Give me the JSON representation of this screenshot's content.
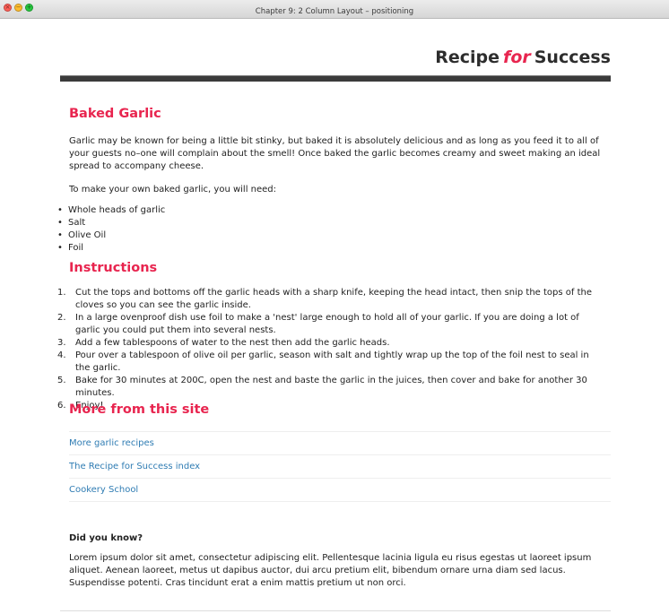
{
  "window": {
    "title": "Chapter 9: 2 Column Layout – positioning"
  },
  "site": {
    "title_part1": "Recipe",
    "title_part2": "for",
    "title_part3": "Success"
  },
  "article": {
    "heading": "Baked Garlic",
    "intro": "Garlic may be known for being a little bit stinky, but baked it is absolutely delicious and as long as you feed it to all of your guests no–one will complain about the smell! Once baked the garlic becomes creamy and sweet making an ideal spread to accompany cheese.",
    "needs": "To make your own baked garlic, you will need:",
    "ingredients": [
      "Whole heads of garlic",
      "Salt",
      "Olive Oil",
      "Foil"
    ],
    "instructions_heading": "Instructions",
    "steps": [
      "Cut the tops and bottoms off the garlic heads with a sharp knife, keeping the head intact, then snip the tops of the cloves so you can see the garlic inside.",
      "In a large ovenproof dish use foil to make a 'nest' large enough to hold all of your garlic. If you are doing a lot of garlic you could put them into several nests.",
      "Add a few tablespoons of water to the nest then add the garlic heads.",
      "Pour over a tablespoon of olive oil per garlic, season with salt and tightly wrap up the top of the foil nest to seal in the garlic.",
      "Bake for 30 minutes at 200C, open the nest and baste the garlic in the juices, then cover and bake for another 30 minutes.",
      "Enjoy!"
    ]
  },
  "more": {
    "heading": "More from this site",
    "links": [
      "More garlic recipes",
      "The Recipe for Success index",
      "Cookery School"
    ]
  },
  "did_you_know": {
    "heading": "Did you know?",
    "text": "Lorem ipsum dolor sit amet, consectetur adipiscing elit. Pellentesque lacinia ligula eu risus egestas ut laoreet ipsum aliquet. Aenean laoreet, metus ut dapibus auctor, dui arcu pretium elit, bibendum ornare urna diam sed lacus. Suspendisse potenti. Cras tincidunt erat a enim mattis pretium ut non orci."
  }
}
